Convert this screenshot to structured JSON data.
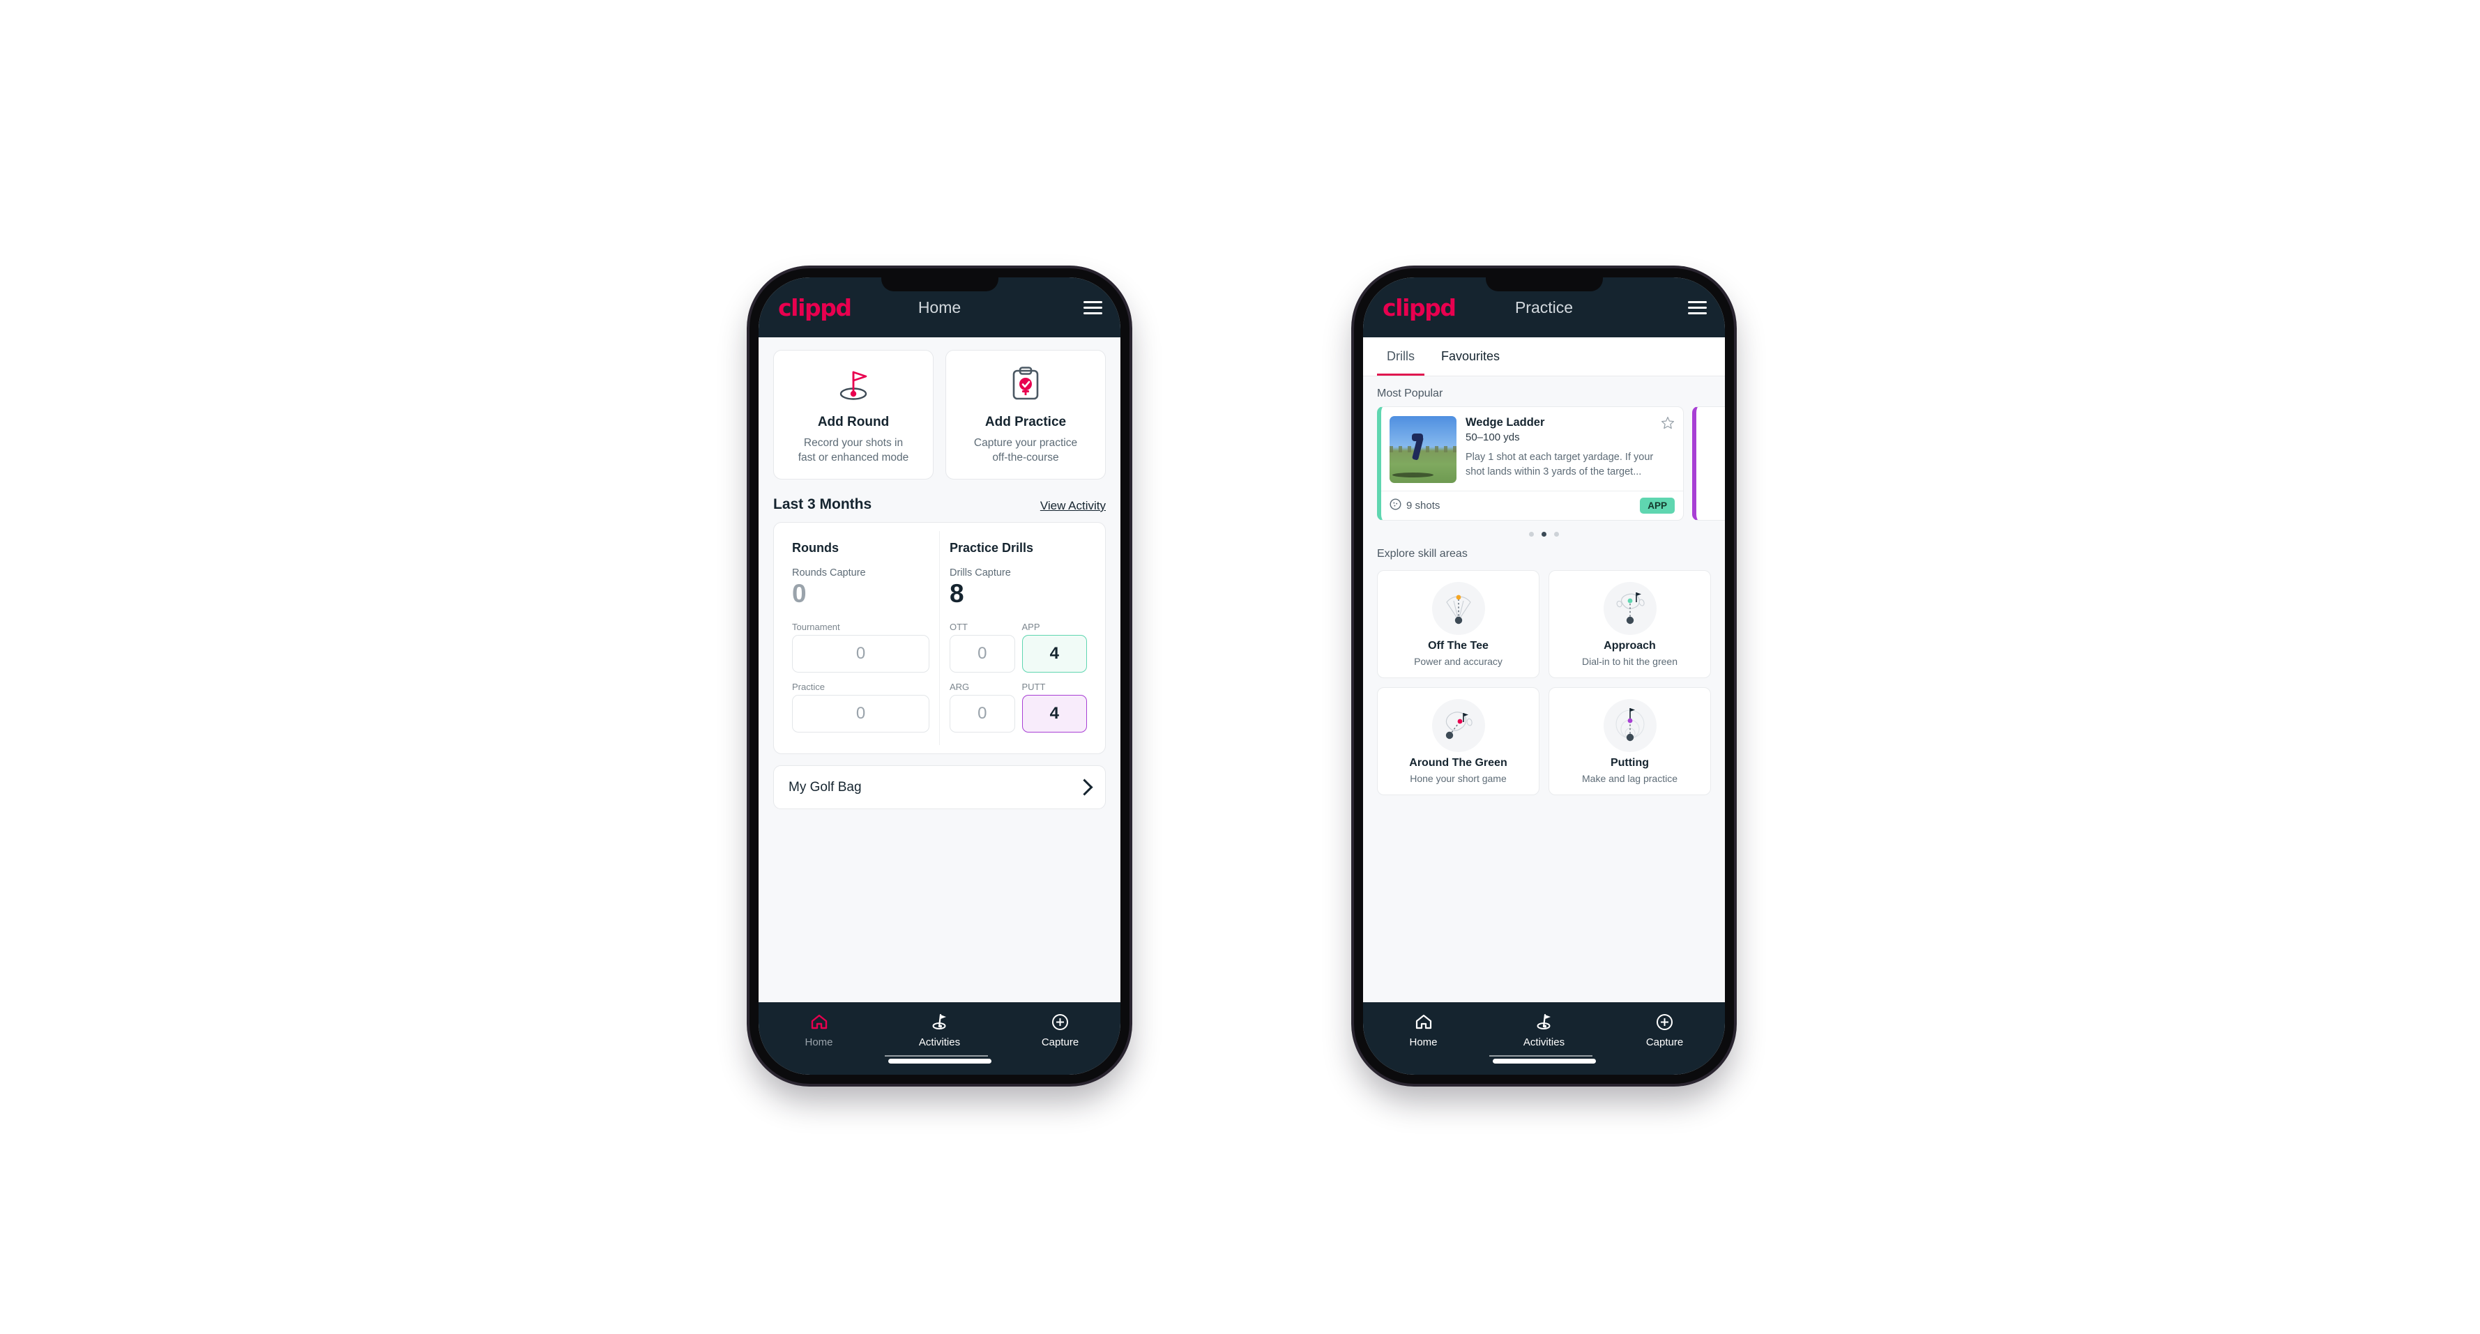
{
  "canvas": {
    "background": "#ffffff"
  },
  "brand": {
    "name": "clippd",
    "pink": "#e8004f",
    "dark": "#15242f",
    "green": "#5fd6b0",
    "purple": "#a83fd4",
    "tab_accent": "#e0174f"
  },
  "phone_home": {
    "appbar": {
      "logo": "clippd",
      "title": "Home",
      "menu_icon": "hamburger-icon"
    },
    "actions": [
      {
        "icon": "golf-flag-hole-icon",
        "title": "Add Round",
        "desc_line1": "Record your shots in",
        "desc_line2": "fast or enhanced mode"
      },
      {
        "icon": "clipboard-check-icon",
        "title": "Add Practice",
        "desc_line1": "Capture your practice",
        "desc_line2": "off-the-course"
      }
    ],
    "section": {
      "title": "Last 3 Months",
      "link": "View Activity"
    },
    "rounds": {
      "title": "Rounds",
      "capture_label": "Rounds Capture",
      "capture_value": "0",
      "fields": [
        {
          "label": "Tournament",
          "value": "0",
          "state": "empty"
        },
        {
          "label": "Practice",
          "value": "0",
          "state": "empty"
        }
      ]
    },
    "drills": {
      "title": "Practice Drills",
      "capture_label": "Drills Capture",
      "capture_value": "8",
      "fields": [
        {
          "label": "OTT",
          "value": "0",
          "state": "empty"
        },
        {
          "label": "APP",
          "value": "4",
          "state": "app"
        },
        {
          "label": "ARG",
          "value": "0",
          "state": "empty"
        },
        {
          "label": "PUTT",
          "value": "4",
          "state": "putt"
        }
      ]
    },
    "golf_bag": {
      "label": "My Golf Bag",
      "chevron": "chevron-right-icon"
    },
    "nav": [
      {
        "label": "Home",
        "icon": "home-icon",
        "active": true
      },
      {
        "label": "Activities",
        "icon": "golf-flag-icon",
        "active": false
      },
      {
        "label": "Capture",
        "icon": "plus-circle-icon",
        "active": false
      }
    ]
  },
  "phone_practice": {
    "appbar": {
      "logo": "clippd",
      "title": "Practice",
      "menu_icon": "hamburger-icon"
    },
    "tabs": [
      {
        "label": "Drills",
        "active": true
      },
      {
        "label": "Favourites",
        "active": false
      }
    ],
    "most_popular_label": "Most Popular",
    "drill": {
      "name": "Wedge Ladder",
      "yardage": "50–100 yds",
      "description": "Play 1 shot at each target yardage. If your shot lands within 3 yards of the target...",
      "shots": "9 shots",
      "shots_icon": "golf-ball-icon",
      "badge": "APP",
      "favourite_icon": "star-outline-icon",
      "accent": "#5fd6b0",
      "next_card_accent": "#a83fd4"
    },
    "carousel_dots": {
      "count": 3,
      "active_index": 1
    },
    "skill_label": "Explore skill areas",
    "skills": [
      {
        "title": "Off The Tee",
        "sub": "Power and accuracy",
        "icon": "tee-fan-icon",
        "dot": "#f5a623"
      },
      {
        "title": "Approach",
        "sub": "Dial-in to hit the green",
        "icon": "green-approach-icon",
        "dot": "#5fd6b0"
      },
      {
        "title": "Around The Green",
        "sub": "Hone your short game",
        "icon": "chip-green-icon",
        "dot": "#e8004f"
      },
      {
        "title": "Putting",
        "sub": "Make and lag practice",
        "icon": "putting-rings-icon",
        "dot": "#a83fd4"
      }
    ],
    "nav": [
      {
        "label": "Home",
        "icon": "home-icon",
        "active": false
      },
      {
        "label": "Activities",
        "icon": "golf-flag-icon",
        "active": true
      },
      {
        "label": "Capture",
        "icon": "plus-circle-icon",
        "active": false
      }
    ]
  }
}
